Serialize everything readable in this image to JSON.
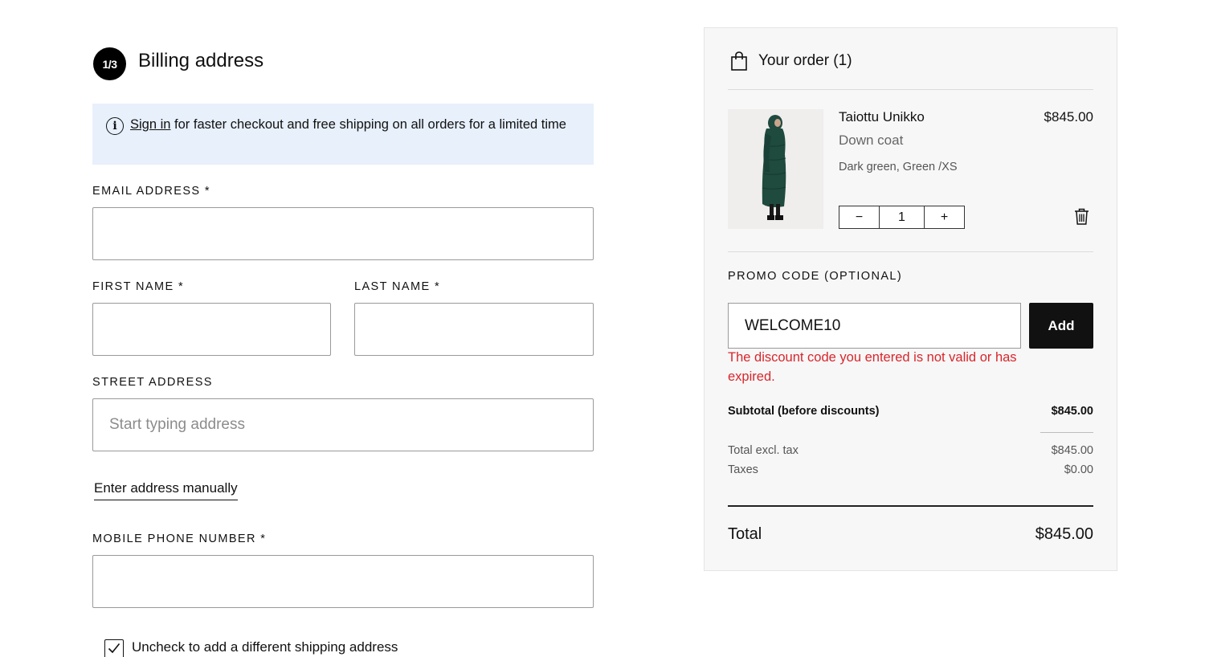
{
  "billing": {
    "step": "1/3",
    "title": "Billing address",
    "notice": {
      "link_text": "Sign in",
      "text": " for faster checkout and free shipping on all orders for a limited time"
    },
    "email": {
      "label": "EMAIL ADDRESS *",
      "value": ""
    },
    "first_name": {
      "label": "FIRST NAME *",
      "value": ""
    },
    "last_name": {
      "label": "LAST NAME *",
      "value": ""
    },
    "street": {
      "label": "STREET ADDRESS",
      "placeholder": "Start typing address",
      "value": ""
    },
    "manual_link": "Enter address manually",
    "phone": {
      "label": "MOBILE PHONE NUMBER *",
      "value": ""
    },
    "shipping_checkbox": {
      "label": "Uncheck to add a different shipping address",
      "checked": true
    }
  },
  "order": {
    "title": "Your order (1)",
    "item": {
      "name": "Taiottu Unikko",
      "type": "Down coat",
      "variant": "Dark green, Green /XS",
      "price": "$845.00",
      "quantity": "1",
      "minus": "−",
      "plus": "+"
    },
    "promo": {
      "label": "PROMO CODE (OPTIONAL)",
      "value": "WELCOME10",
      "add_label": "Add",
      "error": "The discount code you entered is not valid or has expired."
    },
    "subtotal": {
      "label": "Subtotal (before discounts)",
      "value": "$845.00"
    },
    "total_excl_tax": {
      "label": "Total excl. tax",
      "value": "$845.00"
    },
    "taxes": {
      "label": "Taxes",
      "value": "$0.00"
    },
    "total": {
      "label": "Total",
      "value": "$845.00"
    }
  },
  "colors": {
    "accent": "#111111",
    "info_bg": "#e7f0fb",
    "error": "#d8262c",
    "panel_bg": "#f7f7f7",
    "coat": "#1f4a3e"
  },
  "icons": {
    "info": "info-icon",
    "bag": "shopping-bag-icon",
    "trash": "trash-icon",
    "check": "checkmark-icon"
  }
}
